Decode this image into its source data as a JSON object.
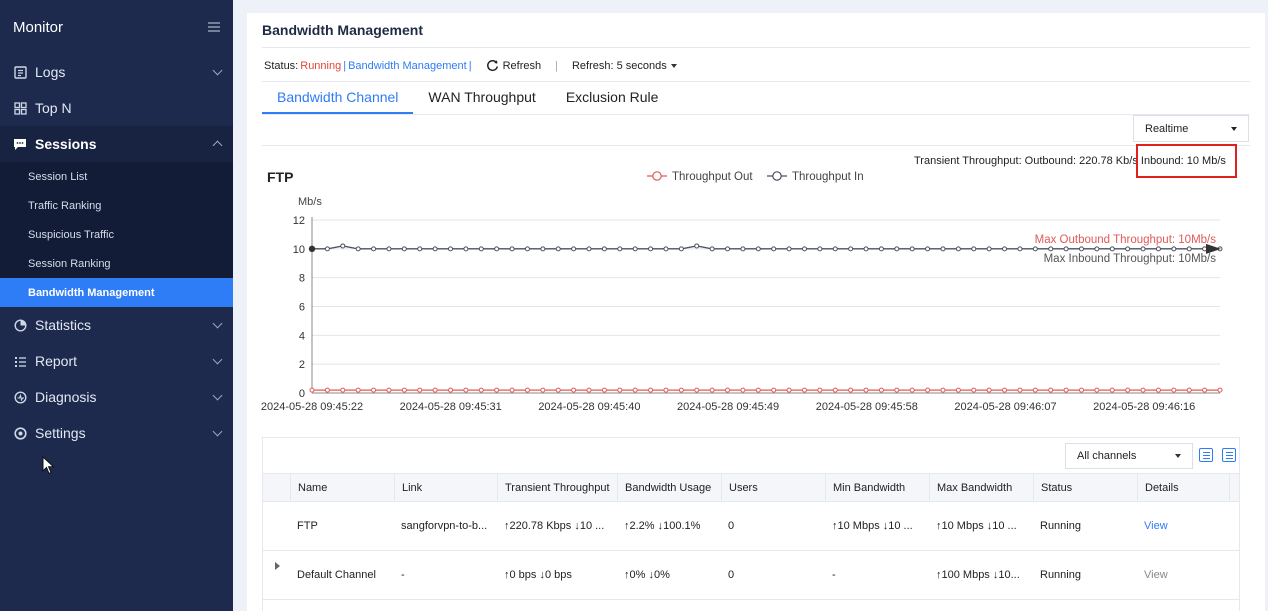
{
  "sidebar": {
    "title": "Monitor",
    "items": [
      {
        "label": "Logs",
        "icon": "logs-icon"
      },
      {
        "label": "Top N",
        "icon": "grid-icon"
      },
      {
        "label": "Sessions",
        "icon": "chat-icon"
      },
      {
        "label": "Statistics",
        "icon": "statistics-icon"
      },
      {
        "label": "Report",
        "icon": "list-icon"
      },
      {
        "label": "Diagnosis",
        "icon": "diagnosis-icon"
      },
      {
        "label": "Settings",
        "icon": "settings-icon"
      }
    ],
    "sessions_sub": [
      "Session List",
      "Traffic Ranking",
      "Suspicious Traffic",
      "Session Ranking",
      "Bandwidth Management"
    ]
  },
  "page": {
    "title": "Bandwidth Management",
    "status_label": "Status:",
    "status_value": "Running",
    "status_sep": "|",
    "status_link": "Bandwidth Management",
    "refresh_button": "Refresh",
    "refresh_pipe": "|",
    "refresh_interval": "Refresh: 5 seconds"
  },
  "tabs": [
    "Bandwidth Channel",
    "WAN Throughput",
    "Exclusion Rule"
  ],
  "mode_select": "Realtime",
  "transient": {
    "outbound": "Transient Throughput: Outbound: 220.78 Kb/s",
    "inbound": "Inbound: 10 Mb/s"
  },
  "chart_data": {
    "type": "line",
    "title": "FTP",
    "ylabel": "Mb/s",
    "ylim": [
      0,
      12
    ],
    "yticks": [
      0,
      2,
      4,
      6,
      8,
      10,
      12
    ],
    "xticks": [
      "2024-05-28 09:45:22",
      "2024-05-28 09:45:31",
      "2024-05-28 09:45:40",
      "2024-05-28 09:45:49",
      "2024-05-28 09:45:58",
      "2024-05-28 09:46:07",
      "2024-05-28 09:46:16"
    ],
    "legend_position": "top-center",
    "series": [
      {
        "name": "Throughput Out",
        "color": "#e05a5a",
        "values": [
          0.2,
          0.2,
          0.2,
          0.2,
          0.2,
          0.2,
          0.2,
          0.2,
          0.2,
          0.2,
          0.2,
          0.2,
          0.2,
          0.2,
          0.2,
          0.2,
          0.2,
          0.2,
          0.2,
          0.2,
          0.2,
          0.2,
          0.2,
          0.2,
          0.2,
          0.2,
          0.2,
          0.2,
          0.2,
          0.2,
          0.2,
          0.2,
          0.2,
          0.2,
          0.2,
          0.2,
          0.2,
          0.2,
          0.2,
          0.2,
          0.2,
          0.2,
          0.2,
          0.2,
          0.2,
          0.2,
          0.2,
          0.2,
          0.2,
          0.2,
          0.2,
          0.2,
          0.2,
          0.2,
          0.2,
          0.2,
          0.2,
          0.2,
          0.2,
          0.2
        ]
      },
      {
        "name": "Throughput In",
        "color": "#4a5060",
        "values": [
          10,
          10,
          10.2,
          10,
          10,
          10,
          10,
          10,
          10,
          10,
          10,
          10,
          10,
          10,
          10,
          10,
          10,
          10,
          10,
          10,
          10,
          10,
          10,
          10,
          10,
          10.2,
          10,
          10,
          10,
          10,
          10,
          10,
          10,
          10,
          10,
          10,
          10,
          10,
          10,
          10,
          10,
          10,
          10,
          10,
          10,
          10,
          10,
          10,
          10,
          10,
          10,
          10,
          10,
          10,
          10,
          10,
          10,
          10,
          10,
          10
        ]
      }
    ],
    "annotations": [
      "Max Outbound Throughput: 10Mb/s",
      "Max Inbound Throughput: 10Mb/s"
    ]
  },
  "table": {
    "channel_select": "All channels",
    "columns": [
      "Name",
      "Link",
      "Transient Throughput",
      "Bandwidth Usage",
      "Users",
      "Min Bandwidth",
      "Max Bandwidth",
      "Status",
      "Details"
    ],
    "rows": [
      [
        "FTP",
        "sangforvpn-to-b...",
        "↑220.78 Kbps ↓10 ...",
        "↑2.2% ↓100.1%",
        "0",
        "↑10 Mbps ↓10 ...",
        "↑10 Mbps ↓10 ...",
        "Running",
        "View"
      ],
      [
        "Default Channel",
        "-",
        "↑0 bps ↓0 bps",
        "↑0% ↓0%",
        "0",
        "-",
        "↑100 Mbps ↓10...",
        "Running",
        "View"
      ]
    ]
  }
}
